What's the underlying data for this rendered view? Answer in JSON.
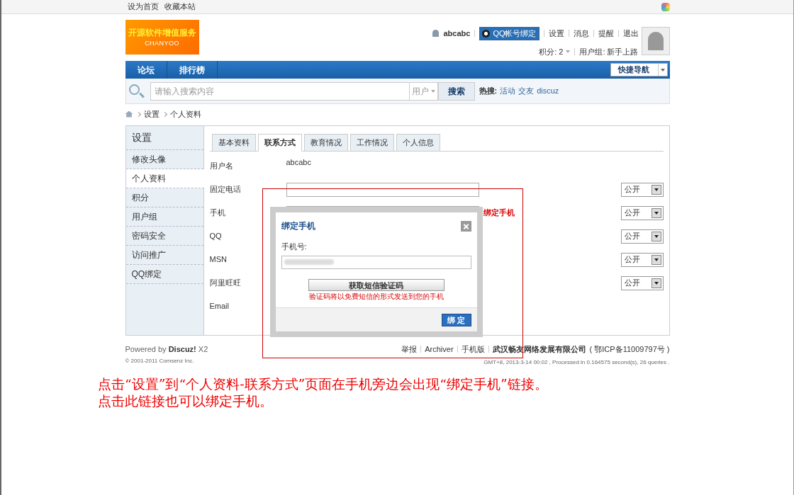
{
  "top_links": [
    "设为首页",
    "收藏本站"
  ],
  "logo": {
    "title": "开源软件增值服务",
    "subtitle": "CHANYOO"
  },
  "user": {
    "name": "abcabc",
    "qq_bind": "QQ帐号绑定",
    "links": [
      "设置",
      "消息",
      "提醒",
      "退出"
    ],
    "credits": "积分: 2",
    "group": "用户组: 新手上路"
  },
  "nav": {
    "items": [
      {
        "label": "论坛",
        "selected": false
      },
      {
        "label": "排行榜",
        "selected": false
      }
    ],
    "quick_nav": "快捷导航"
  },
  "search": {
    "placeholder": "请输入搜索内容",
    "type": "用户",
    "button": "搜索",
    "hot_label": "热搜:",
    "hot_links": [
      "活动",
      "交友",
      "discuz"
    ]
  },
  "breadcrumb": [
    "设置",
    "个人资料"
  ],
  "sidebar": {
    "title": "设置",
    "items": [
      {
        "label": "修改头像",
        "selected": false
      },
      {
        "label": "个人资料",
        "selected": true
      },
      {
        "label": "积分",
        "selected": false
      },
      {
        "label": "用户组",
        "selected": false
      },
      {
        "label": "密码安全",
        "selected": false
      },
      {
        "label": "访问推广",
        "selected": false
      },
      {
        "label": "QQ绑定",
        "selected": false
      }
    ]
  },
  "tabs": [
    {
      "label": "基本资料",
      "selected": false
    },
    {
      "label": "联系方式",
      "selected": true
    },
    {
      "label": "教育情况",
      "selected": false
    },
    {
      "label": "工作情况",
      "selected": false
    },
    {
      "label": "个人信息",
      "selected": false
    }
  ],
  "form_rows": [
    {
      "label": "用户名",
      "kind": "text",
      "value": "abcabc"
    },
    {
      "label": "固定电话",
      "kind": "input",
      "privacy": "公开"
    },
    {
      "label": "手机",
      "kind": "input",
      "privacy": "公开",
      "link": "绑定手机"
    },
    {
      "label": "QQ",
      "kind": "covered",
      "privacy": "公开"
    },
    {
      "label": "MSN",
      "kind": "covered",
      "privacy": "公开"
    },
    {
      "label": "阿里旺旺",
      "kind": "covered",
      "privacy": "公开"
    },
    {
      "label": "Email",
      "kind": "covered"
    }
  ],
  "dialog": {
    "title": "绑定手机",
    "field_label": "手机号:",
    "send_button": "获取短信验证码",
    "note": "验证码将以免费短信的形式发送到您的手机",
    "confirm_button": "绑 定"
  },
  "footer": {
    "powered_prefix": "Powered by",
    "powered_brand": "Discuz!",
    "powered_version": "X2",
    "copyright": "© 2001-2011 Comsenz Inc.",
    "links": [
      "举报",
      "Archiver",
      "手机版"
    ],
    "company": "武汉畅友网络发展有限公司",
    "icp": "( 鄂ICP备11009797号 )",
    "stats": "GMT+8, 2013-3-14 00:02 , Processed in 0.164575 second(s), 26 queries ."
  },
  "annotation": [
    "点击“设置”到“个人资料-联系方式”页面在手机旁边会出现“绑定手机”链接。",
    "点击此链接也可以绑定手机。"
  ]
}
